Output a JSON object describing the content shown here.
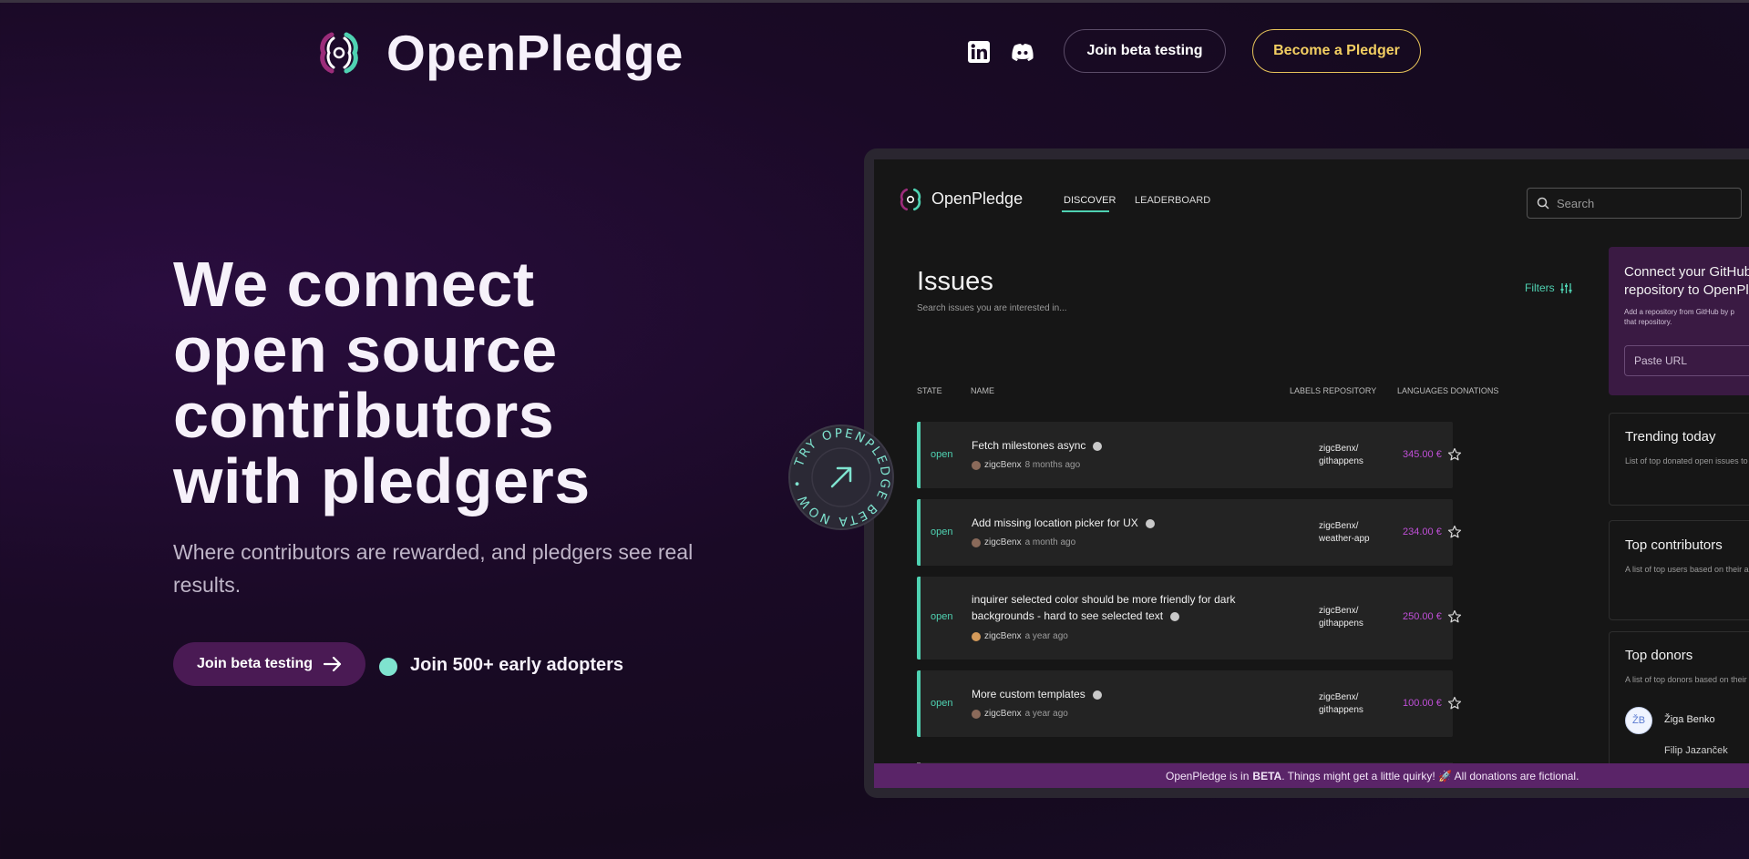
{
  "header": {
    "brand": "OpenPledge",
    "join_beta_label": "Join beta testing",
    "become_pledger_label": "Become a Pledger",
    "icons": [
      "linkedin-icon",
      "discord-icon"
    ]
  },
  "hero": {
    "title_lines": [
      "We connect",
      "open source",
      "contributors",
      "with pledgers"
    ],
    "subtitle": "Where contributors are rewarded, and pledgers see real results.",
    "cta_label": "Join beta testing",
    "adopters": "Join 500+ early adopters"
  },
  "badge": {
    "text": "TRY OPENPLEDGE BETA NOW • "
  },
  "app": {
    "brand": "OpenPledge",
    "nav": {
      "discover": "DISCOVER",
      "leaderboard": "LEADERBOARD"
    },
    "search": {
      "placeholder": "Search"
    },
    "issues": {
      "title": "Issues",
      "subtitle": "Search issues you are interested in...",
      "filters": "Filters"
    },
    "columns": {
      "state": "STATE",
      "name": "NAME",
      "labels_repository": "LABELS REPOSITORY",
      "languages_donations": "LANGUAGES DONATIONS"
    },
    "rows": [
      {
        "state": "open",
        "name": "Fetch milestones async",
        "user": "zigcBenx",
        "time": "8 months ago",
        "repo_owner": "zigcBenx/",
        "repo_name": "githappens",
        "amount": "345.00 €"
      },
      {
        "state": "open",
        "name": "Add missing location picker for UX",
        "user": "zigcBenx",
        "time": "a month ago",
        "repo_owner": "zigcBenx/",
        "repo_name": "weather-app",
        "amount": "234.00 €"
      },
      {
        "state": "open",
        "name_line1": "inquirer selected color should be more friendly for dark",
        "name_line2": "backgrounds - hard to see selected text",
        "user": "zigcBenx",
        "time": "a year ago",
        "repo_owner": "zigcBenx/",
        "repo_name": "githappens",
        "amount": "250.00 €"
      },
      {
        "state": "open",
        "name": "More custom templates",
        "user": "zigcBenx",
        "time": "a year ago",
        "repo_owner": "zigcBenx/",
        "repo_name": "githappens",
        "amount": "100.00 €"
      }
    ],
    "connect": {
      "title_line1": "Connect your GitHub",
      "title_line2": "repository to OpenPl",
      "sub_line1": "Add a repository from GitHub by p",
      "sub_line2": "that repository.",
      "input_placeholder": "Paste URL"
    },
    "trending": {
      "title": "Trending today",
      "subtitle": "List of top donated open issues to"
    },
    "contributors": {
      "title": "Top contributors",
      "subtitle": "A list of top users based on their a"
    },
    "donors": {
      "title": "Top donors",
      "subtitle": "A list of top donors based on their",
      "first_initials": "ŽB",
      "first_name": "Žiga Benko",
      "second_name": "Filip Jazanček"
    },
    "banner": {
      "prefix": "OpenPledge is in",
      "beta": "BETA",
      "suffix": ". Things might get a little quirky! 🚀 All donations are fictional."
    }
  },
  "colors": {
    "accent": "#4fd2b2",
    "amount": "#c04fd8",
    "pledger": "#f3cf62",
    "banner": "#5a2468"
  }
}
